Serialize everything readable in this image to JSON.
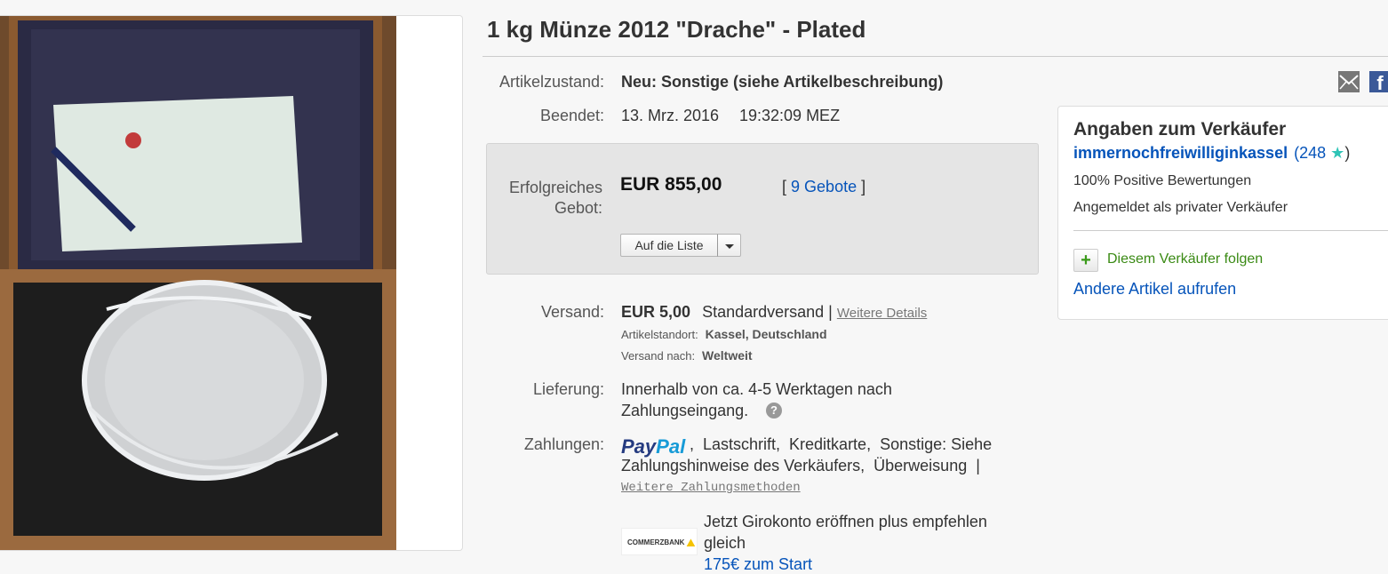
{
  "title": "1 kg Münze 2012 \"Drache\" - Plated",
  "condition": {
    "label": "Artikelzustand:",
    "value": "Neu: Sonstige (siehe Artikelbeschreibung)"
  },
  "ended": {
    "label": "Beendet:",
    "date": "13. Mrz. 2016",
    "time": "19:32:09 MEZ"
  },
  "bid": {
    "label_line1": "Erfolgreiches",
    "label_line2": "Gebot:",
    "price": "EUR 855,00",
    "bids_open": "[",
    "bids_link": "9 Gebote",
    "bids_close": "]",
    "watch_button": "Auf die Liste"
  },
  "shipping": {
    "label": "Versand:",
    "price": "EUR 5,00",
    "method": "Standardversand |",
    "details_link": "Weitere Details",
    "location_label": "Artikelstandort:",
    "location_value": "Kassel, Deutschland",
    "ships_to_label": "Versand nach:",
    "ships_to_value": "Weltweit"
  },
  "delivery": {
    "label": "Lieferung:",
    "line1": "Innerhalb von ca. 4-5 Werktagen nach",
    "line2": "Zahlungseingang."
  },
  "payments": {
    "label": "Zahlungen:",
    "paypal_part1": "Pay",
    "paypal_part2": "Pal",
    "line1": ",  Lastschrift,  Kreditkarte,  Sonstige: Siehe",
    "line2": "Zahlungshinweise des Verkäufers,  Überweisung  |",
    "more_link": "Weitere Zahlungsmethoden"
  },
  "promo": {
    "bank_logo": "COMMERZBANK",
    "line1": "Jetzt Girokonto eröffnen plus empfehlen",
    "line2": "gleich",
    "link": "175€ zum Start"
  },
  "seller": {
    "heading": "Angaben zum Verkäufer",
    "name": "immernochfreiwilliginkassel",
    "score_open": "(",
    "score": "248",
    "score_close": ")",
    "positive": "100% Positive Bewertungen",
    "type": "Angemeldet als privater Verkäufer",
    "follow": "Diesem Verkäufer folgen",
    "other_items": "Andere Artikel aufrufen"
  },
  "social": {
    "fb_letter": "f"
  },
  "colors": {
    "link": "#0654ba",
    "follow_green": "#3a8a14",
    "star_teal": "#2ec4b6",
    "paypal_dark": "#253b80",
    "paypal_light": "#179bd7"
  }
}
